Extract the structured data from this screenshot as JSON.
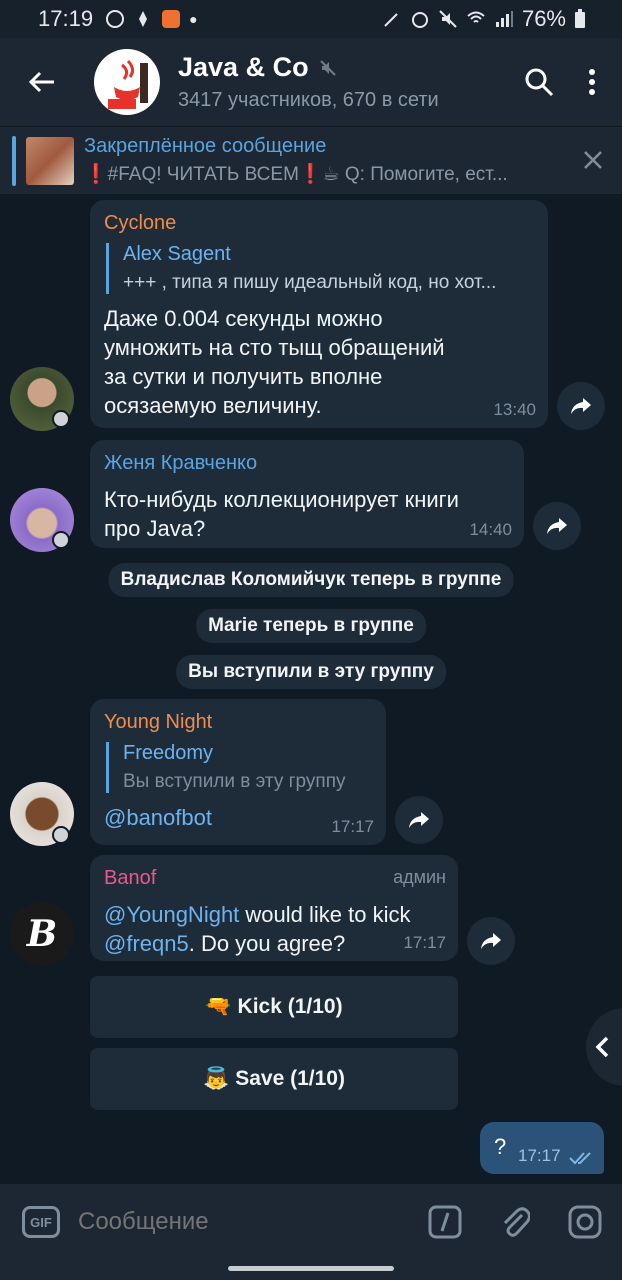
{
  "status_bar": {
    "time": "17:19",
    "battery": "76%"
  },
  "header": {
    "title": "Java & Co",
    "subtitle": "3417 участников, 670 в сети",
    "avatar_text": "Java"
  },
  "pinned": {
    "title": "Закреплённое сообщение",
    "preview_pre": "❗#FAQ! ЧИТАТЬ ВСЕМ❗☕ Q: Помогите, ест..."
  },
  "messages": [
    {
      "sender": "Cyclone",
      "sender_color": "#f08c4c",
      "reply_name": "Alex Sagent",
      "reply_text": "+++ , типа я пишу идеальный код, но хот...",
      "lines": [
        "Даже 0.004 секунды можно",
        "умножить на сто тыщ обращений",
        "за сутки и получить вполне",
        "осязаемую величину."
      ],
      "time": "13:40"
    },
    {
      "sender": "Женя Кравченко",
      "sender_color": "#5aa4e0",
      "lines": [
        "Кто-нибудь коллекционирует книги",
        "про Java?"
      ],
      "time": "14:40"
    },
    {
      "sender": "Young Night",
      "sender_color": "#f08c4c",
      "reply_name": "Freedomy",
      "reply_text": "Вы вступили в эту группу",
      "text": "@banofbot",
      "time": "17:17"
    },
    {
      "sender": "Banof",
      "sender_color": "#e85a8a",
      "badge": "админ",
      "mention1": "@YoungNight",
      "text1": " would like to kick",
      "mention2": "@freqn5",
      "text2": ". Do you agree?",
      "time": "17:17"
    }
  ],
  "service": [
    "Владислав Коломийчук теперь в группе",
    "Marie теперь в группе",
    "Вы вступили в эту группу"
  ],
  "inline_buttons": [
    {
      "emoji": "🔫",
      "label": "Kick (1/10)"
    },
    {
      "emoji": "👼",
      "label": "Save (1/10)"
    }
  ],
  "outgoing": {
    "text": "?",
    "time": "17:17"
  },
  "input": {
    "placeholder": "Сообщение",
    "gif_label": "GIF"
  }
}
